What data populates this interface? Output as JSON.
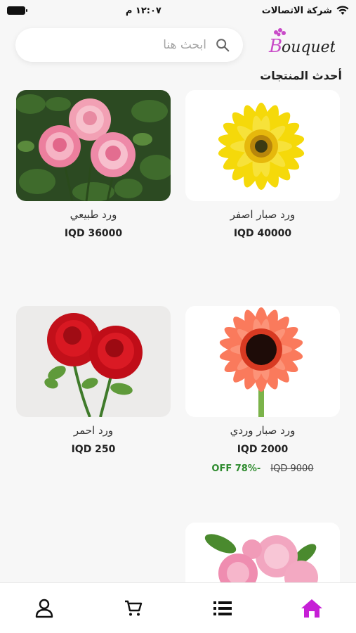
{
  "status_bar": {
    "carrier": "شركة الاتصالات",
    "time": "١٢:٠٧ م",
    "wifi_icon": "wifi-icon",
    "battery_icon": "battery-icon"
  },
  "header": {
    "logo_text": "Bouquet",
    "search_placeholder": "ابحث هنا",
    "search_icon": "search-icon"
  },
  "section_title": "أحدث المنتجات",
  "products": [
    {
      "name": "ورد صبار اصفر",
      "price": "IQD 40000"
    },
    {
      "name": "ورد طبيعي",
      "price": "IQD 36000"
    },
    {
      "name": "ورد صبار وردي",
      "price": "IQD 2000",
      "old_price": "IQD 9000",
      "discount": "OFF 78%-"
    },
    {
      "name": "ورد احمر",
      "price": "IQD 250"
    },
    {
      "name": "",
      "price": ""
    }
  ],
  "bottom_nav": {
    "active_color": "#c61fd6",
    "items": [
      "profile-icon",
      "cart-icon",
      "list-icon",
      "home-icon"
    ]
  }
}
